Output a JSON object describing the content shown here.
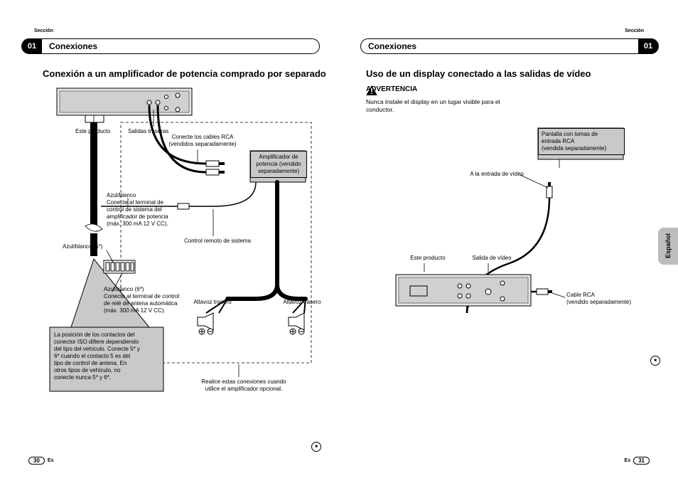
{
  "meta": {
    "section_label": "Sección",
    "section_number": "01",
    "section_title": "Conexiones",
    "language_tab": "Español",
    "lang_code": "Es"
  },
  "left_page": {
    "number": "30",
    "heading": "Conexión a un amplificador de potencia comprado por separado",
    "labels": {
      "este_producto": "Este producto",
      "salidas_traseras": "Salidas traseras",
      "conecte_rca": "Conecte los cables RCA\n(vendidos separadamente)",
      "amplificador": "Amplificador de\npotencia (vendido\nseparadamente)",
      "azul_blanco_main": "Azul/blanco\nConecte al terminal de\ncontrol de sistema del\namplificador de potencia\n(máx. 300 mA 12 V CC).",
      "control_remoto": "Control remoto de sistema",
      "azul_blanco_5": "Azul/blanco (5*)",
      "azul_blanco_6": "Azul/blanco (6*)\nConecte al terminal de control\nde relé de antena automática\n(máx. 300 mA 12 V CC).",
      "iso_note": "La posición de los contactos del\nconector ISO difiere dependiendo\ndel tipo del vehículo. Conecte 5* y\n6* cuando el contacto 5 es del\ntipo de control de antena. En\notros tipos de vehículo, no\nconecte nunca 5* y 6*.",
      "altavoz_left": "Altavoz trasero",
      "altavoz_right": "Altavoz trasero",
      "realice": "Realice estas conexiones cuando\nutilice el amplificador opcional."
    }
  },
  "right_page": {
    "number": "31",
    "heading": "Uso de un display conectado a las salidas de vídeo",
    "warning_label": "ADVERTENCIA",
    "warning_text": "Nunca instale el display en un lugar visible para el conductor.",
    "labels": {
      "pantalla_rca": "Pantalla con tomas de\nentrada RCA\n(vendida separadamente)",
      "a_entrada_video": "A la entrada de vídeo",
      "este_producto": "Este producto",
      "salida_video": "Salida de vídeo",
      "cable_rca": "Cable RCA\n(vendido separadamente)"
    }
  }
}
